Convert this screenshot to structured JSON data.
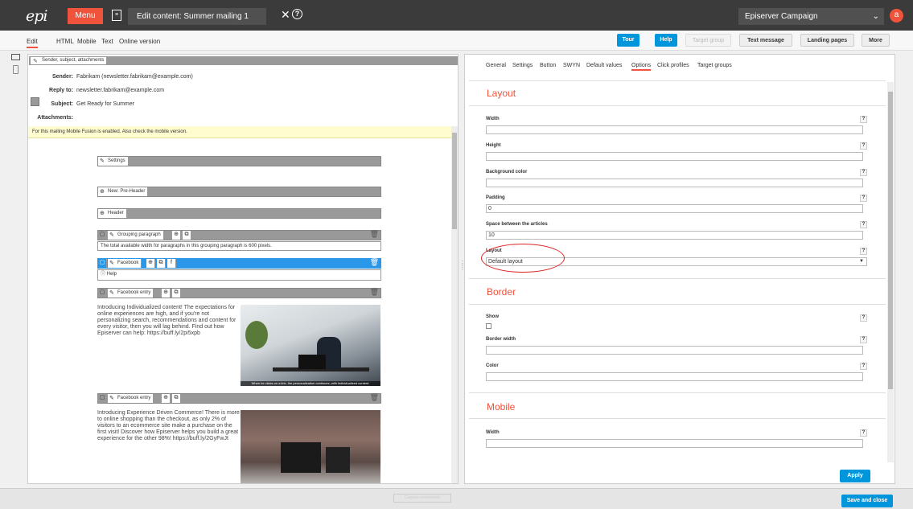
{
  "topbar": {
    "logo": "epi",
    "menu": "Menu",
    "title": "Edit content: Summer mailing 1",
    "close": "✕",
    "help": "?",
    "account": "Episerver Campaign",
    "avatar": "a"
  },
  "toolbar": {
    "tabs": [
      "Edit",
      "HTML",
      "Mobile",
      "Text",
      "Online version"
    ],
    "buttons": [
      "Tour",
      "Help",
      "Target group",
      "Text message",
      "Landing pages",
      "More"
    ]
  },
  "left": {
    "header_label": "Sender, subject, attachments",
    "sender_label": "Sender:",
    "sender": "Fabrikam (newsletter.fabrikam@example.com)",
    "reply_label": "Reply to:",
    "reply": "newsletter.fabrikam@example.com",
    "subject_label": "Subject:",
    "subject": "Get Ready for Summer",
    "attachments_label": "Attachments:",
    "notice": "For this mailing Mobile Fusion is enabled. Also check the mobile version.",
    "blocks": {
      "settings": "Settings",
      "preheader": "New: Pre-Header",
      "header": "Header",
      "grouping": "Grouping paragraph",
      "grouping_text": "The total available width for paragraphs in this grouping paragraph is 600 pixels.",
      "facebook": "Facebook",
      "help": "Help",
      "fb_entry": "Facebook entry",
      "fb_entry2": "Facebook entry"
    },
    "article1": "Introducing Individualized content! The expectations for online experiences are high, and if you're not personalizing search, recommendations and content for every visitor, then you will lag behind. Find out how Episerver can help: https://buff.ly/2pi5xpb",
    "caption1": "When he clicks on a link, the personalization continues, with individualized content.",
    "article2": "Introducing Experience Driven Commerce! There is more to online shopping than the checkout, as only 2% of visitors to an ecommerce site make a purchase on the first visit! Discover how Episerver helps you build a great experience for the other 98%! https://buff.ly/2GyFwJt"
  },
  "right": {
    "tabs": [
      "General",
      "Settings",
      "Button",
      "SWYN",
      "Default values",
      "Options",
      "Click profiles",
      "Target groups"
    ],
    "layout_title": "Layout",
    "width_label": "Width",
    "height_label": "Height",
    "bg_label": "Background color",
    "padding_label": "Padding",
    "padding": "0",
    "space_label": "Space between the articles",
    "space": "10",
    "layout_label": "Layout",
    "layout_value": "Default layout",
    "border_title": "Border",
    "show_label": "Show",
    "border_width_label": "Border width",
    "color_label": "Color",
    "mobile_title": "Mobile",
    "mobile_width_label": "Width",
    "apply": "Apply"
  },
  "bottom": {
    "capture": "Capture screenshot",
    "save": "Save and close"
  }
}
